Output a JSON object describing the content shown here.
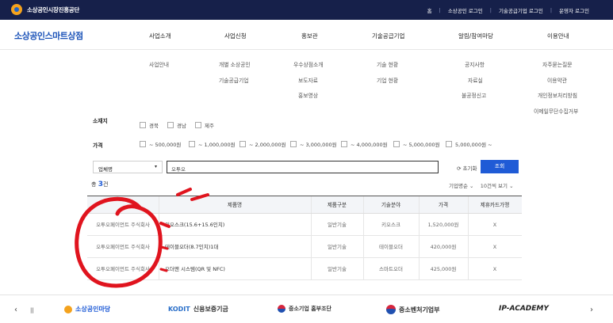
{
  "topbar": {
    "brand": "소상공인시장진흥공단",
    "links": [
      "홈",
      "소상공인 로그인",
      "기술공급기업 로그인",
      "운영자 로그인"
    ]
  },
  "gnb": {
    "logo": "소상공인스마트상점",
    "menu": [
      "사업소개",
      "사업신청",
      "홍보관",
      "기술공급기업",
      "알림/참여마당",
      "이용안내"
    ]
  },
  "mega": {
    "col1": [
      "사업안내"
    ],
    "col2": [
      "개별 소상공인",
      "기술공급기업"
    ],
    "col3": [
      "우수상점소개",
      "보도자료",
      "홍보영상"
    ],
    "col4": [
      "기술 현황",
      "기업 현황"
    ],
    "col5": [
      "공지사항",
      "자료실",
      "불공정신고"
    ],
    "col6": [
      "자주묻는질문",
      "이용약관",
      "개인정보처리방침",
      "이메일무단수집거부"
    ]
  },
  "filters": {
    "region_label": "소재지",
    "regions": [
      "경북",
      "경남",
      "제주"
    ],
    "price_label": "가격",
    "prices": [
      "~ 500,000원",
      "~ 1,000,000원",
      "~ 2,000,000원",
      "~ 3,000,000원",
      "~ 4,000,000원",
      "~ 5,000,000원",
      "5,000,000원 ~"
    ]
  },
  "search": {
    "select_value": "업체명",
    "query": "오투오",
    "reset_label": "초기화",
    "submit_label": "조회"
  },
  "results": {
    "total_prefix": "총",
    "count": "3",
    "total_suffix": "건",
    "sort": "기업명순",
    "per_page": "10건씩 보기"
  },
  "table": {
    "headers": [
      "",
      "제품명",
      "제품구분",
      "기술분야",
      "가격",
      "제휴카드가맹"
    ],
    "rows": [
      {
        "company": "오투오페이먼트 주식회사",
        "product": "키오스크(15.6+15.6인치)",
        "kind": "일반기술",
        "field": "키오스크",
        "price": "1,520,000원",
        "card": "X"
      },
      {
        "company": "오투오페이먼트 주식회사",
        "product": "테이블오더(8.7인치)1대",
        "kind": "일반기술",
        "field": "테이블오더",
        "price": "420,000원",
        "card": "X"
      },
      {
        "company": "오투오페이먼트 주식회사",
        "product": "오더앤 시스템(QR 및 NFC)",
        "kind": "일반기술",
        "field": "스마트오더",
        "price": "425,000원",
        "card": "X"
      }
    ]
  },
  "partners": {
    "prev": "‹",
    "pause": "||",
    "next": "›",
    "logos": [
      "소상공인마당",
      "신용보증기금",
      "중소기업 홈부조단",
      "중소벤처기업부",
      "IP-ACADEMY"
    ]
  },
  "colors": {
    "navy": "#16204a",
    "blue": "#1f5bd6",
    "annotation_red": "#e0141e"
  }
}
